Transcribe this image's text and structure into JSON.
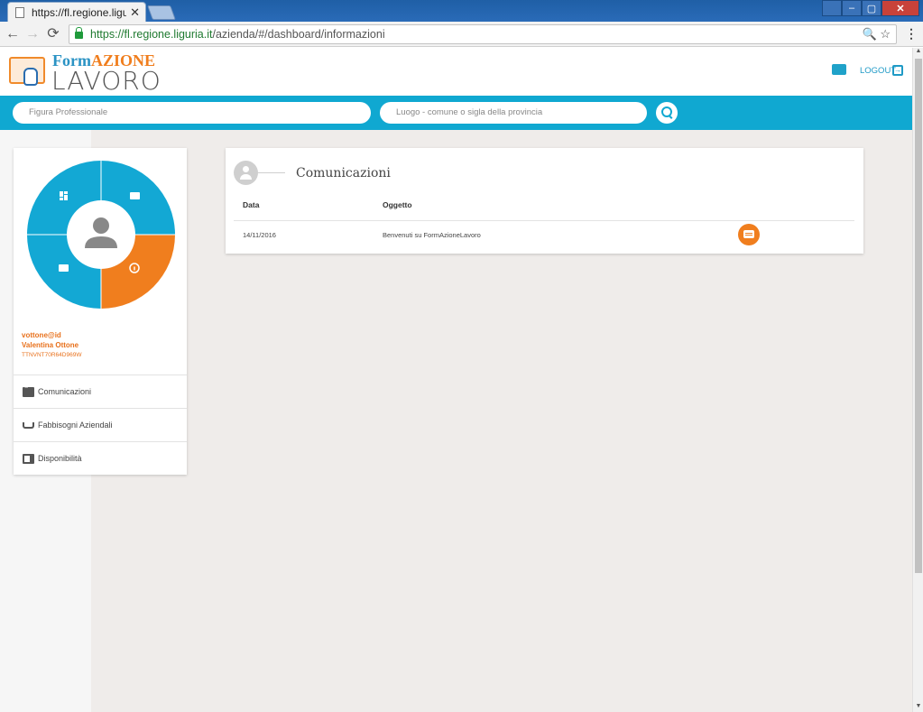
{
  "browser": {
    "tab_title": "https://fl.regione.liguria.",
    "tab_close": "✕",
    "url_secure": "https://fl.regione.liguria.it",
    "url_path": "/azienda/#/dashboard/informazioni",
    "back": "←",
    "forward": "→",
    "reload": "⟳",
    "zoom_star": "🔍 ☆",
    "menu": "⋮"
  },
  "window_controls": {
    "minimize": "–",
    "maximize": "▢",
    "close": "✕"
  },
  "header": {
    "logo_form": "Form",
    "logo_azione": "AZIONE",
    "logo_lavoro": "LAVORO",
    "logout_label": "LOGOUT",
    "logout_icon": "→"
  },
  "search": {
    "figura_placeholder": "Figura Professionale",
    "luogo_placeholder": "Luogo - comune o sigla della provincia"
  },
  "sidebar": {
    "username": "vottone@id",
    "fullname": "Valentina Ottone",
    "fiscal_code": "TTNVNT70R64D969W",
    "items": [
      {
        "label": "Comunicazioni",
        "icon": "chat-icon"
      },
      {
        "label": "Fabbisogni Aziendali",
        "icon": "basket-icon"
      },
      {
        "label": "Disponibilità",
        "icon": "book-icon"
      }
    ]
  },
  "main": {
    "title": "Comunicazioni",
    "columns": [
      "Data",
      "Oggetto"
    ],
    "rows": [
      {
        "data": "14/11/2016",
        "oggetto": "Benvenuti su FormAzioneLavoro"
      }
    ]
  },
  "colors": {
    "brand_blue": "#10a8d1",
    "brand_orange": "#f07e1e",
    "wheel_blue": "#13a8d4"
  }
}
